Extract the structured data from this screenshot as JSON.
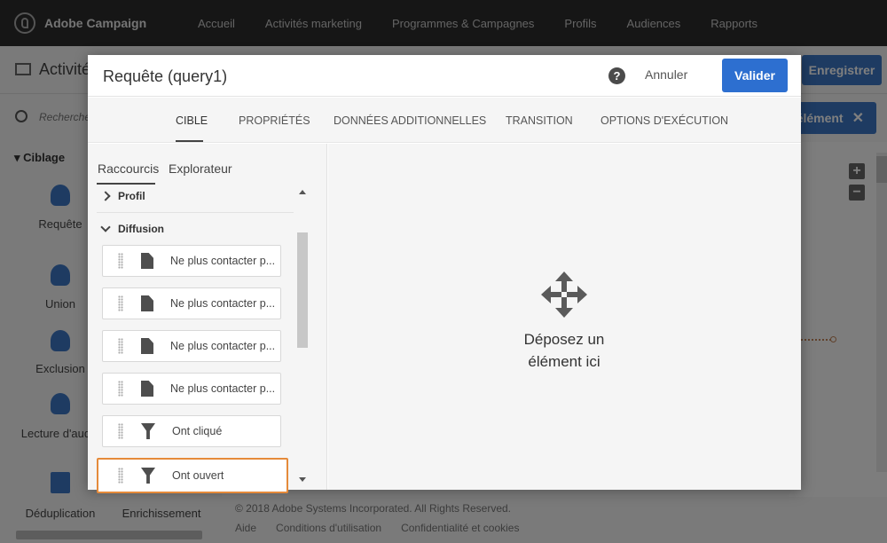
{
  "topnav": {
    "brand": "Adobe Campaign",
    "links": [
      "Accueil",
      "Activités marketing",
      "Programmes & Campagnes",
      "Profils",
      "Audiences",
      "Rapports"
    ]
  },
  "background": {
    "page_title": "Activité",
    "save_button": "Enregistrer",
    "element_button": "élément",
    "search_placeholder": "Recherche...",
    "category": "Ciblage",
    "activities": [
      "Requête",
      "Union",
      "Exclusion",
      "Lecture d'audie",
      "Déduplication",
      "Enrichissement"
    ],
    "copyright": "© 2018 Adobe Systems Incorporated. All Rights Reserved.",
    "footer_links": [
      "Aide",
      "Conditions d'utilisation",
      "Confidentialité et cookies"
    ]
  },
  "modal": {
    "title": "Requête (query1)",
    "help": "?",
    "cancel": "Annuler",
    "validate": "Valider",
    "tabs": [
      "CIBLE",
      "PROPRIÉTÉS",
      "DONNÉES ADDITIONNELLES",
      "TRANSITION",
      "OPTIONS D'EXÉCUTION"
    ],
    "active_tab": "CIBLE",
    "subtabs": [
      "Raccourcis",
      "Explorateur"
    ],
    "sections": [
      "Profil",
      "Diffusion"
    ],
    "items": [
      {
        "label": "Ne plus contacter p...",
        "icon": "document-icon"
      },
      {
        "label": "Ne plus contacter p...",
        "icon": "document-icon"
      },
      {
        "label": "Ne plus contacter p...",
        "icon": "document-icon"
      },
      {
        "label": "Ne plus contacter p...",
        "icon": "document-icon"
      },
      {
        "label": "Ont cliqué",
        "icon": "filter-icon"
      },
      {
        "label": "Ont ouvert",
        "icon": "filter-icon"
      }
    ],
    "drop_text_line1": "Déposez un",
    "drop_text_line2": "élément ici"
  },
  "colors": {
    "primary": "#2d6fd0",
    "highlight": "#e58a3a",
    "topnav": "#2c2c2c"
  }
}
